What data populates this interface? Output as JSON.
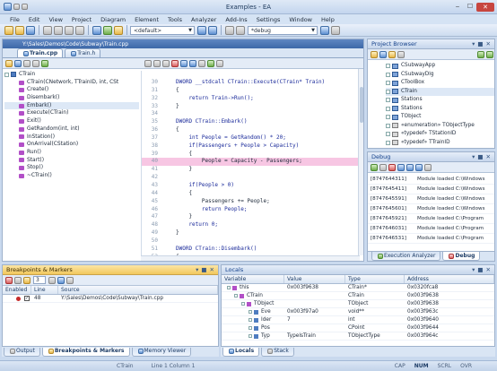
{
  "window": {
    "title": "Examples - EA"
  },
  "menu": [
    "File",
    "Edit",
    "View",
    "Project",
    "Diagram",
    "Element",
    "Tools",
    "Analyzer",
    "Add-Ins",
    "Settings",
    "Window",
    "Help"
  ],
  "toolbar": {
    "default_select": "<default>",
    "debug_select": "*debug"
  },
  "path": {
    "text": "Y:\\Sales\\Demos\\Code\\Subway\\Train.cpp"
  },
  "tabs": [
    {
      "label": "Train.cpp"
    },
    {
      "label": "Train.h"
    }
  ],
  "classtree": {
    "root": "CTrain",
    "members": [
      "CTrain(CNetwork, TTrainID, int, CSt",
      "Create()",
      "Disembark()",
      "Embark()",
      "Execute(CTrain)",
      "Exit()",
      "GetRandom(int, int)",
      "InStation()",
      "OnArrival(CStation)",
      "Run()",
      "Start()",
      "Stop()",
      "~CTrain()"
    ]
  },
  "code": {
    "lines": [
      {
        "n": "30",
        "t": "DWORD __stdcall CTrain::Execute(CTrain* Train)"
      },
      {
        "n": "31",
        "t": "{"
      },
      {
        "n": "32",
        "t": "    return Train->Run();"
      },
      {
        "n": "33",
        "t": "}"
      },
      {
        "n": "34",
        "t": ""
      },
      {
        "n": "35",
        "t": "DWORD CTrain::Embark()"
      },
      {
        "n": "36",
        "t": "{"
      },
      {
        "n": "37",
        "t": "    int People = GetRandom() * 20;"
      },
      {
        "n": "38",
        "t": "    if(Passengers + People > Capacity)"
      },
      {
        "n": "39",
        "t": "    {"
      },
      {
        "n": "40",
        "t": "        People = Capacity - Passengers;"
      },
      {
        "n": "41",
        "t": "    }"
      },
      {
        "n": "42",
        "t": ""
      },
      {
        "n": "43",
        "t": "    if(People > 0)"
      },
      {
        "n": "44",
        "t": "    {"
      },
      {
        "n": "45",
        "t": "        Passengers += People;"
      },
      {
        "n": "46",
        "t": "        return People;"
      },
      {
        "n": "47",
        "t": "    }"
      },
      {
        "n": "48",
        "t": "    return 0;"
      },
      {
        "n": "49",
        "t": "}"
      },
      {
        "n": "50",
        "t": ""
      },
      {
        "n": "51",
        "t": "DWORD CTrain::Disembark()"
      },
      {
        "n": "52",
        "t": "{"
      },
      {
        "n": "53",
        "t": "    int People = GetRandom();"
      }
    ],
    "highlight_line": "40"
  },
  "project_browser": {
    "title": "Project Browser",
    "items": [
      "CSubwayApp",
      "CSubwayDlg",
      "CToolBox",
      "CTrain",
      "Stations",
      "Stations",
      "TObject",
      "«enumeration» TObjectType",
      "«typedef» TStationID",
      "«typedef» TTrainID"
    ]
  },
  "debug": {
    "title": "Debug",
    "rows": [
      {
        "id": "[8747644311]",
        "msg": "Module loaded C:\\Windows"
      },
      {
        "id": "[8747645411]",
        "msg": "Module loaded C:\\Windows"
      },
      {
        "id": "[8747645591]",
        "msg": "Module loaded C:\\Windows"
      },
      {
        "id": "[8747645601]",
        "msg": "Module loaded C:\\Windows"
      },
      {
        "id": "[8747645921]",
        "msg": "Module loaded C:\\Program"
      },
      {
        "id": "[8747646031]",
        "msg": "Module loaded C:\\Program"
      },
      {
        "id": "[8747646531]",
        "msg": "Module loaded C:\\Program"
      }
    ],
    "tabs": [
      "Execution Analyzer",
      "Debug"
    ]
  },
  "breakpoints": {
    "title": "Breakpoints & Markers",
    "count": "3",
    "headers": [
      "Enabled",
      "Line",
      "Source"
    ],
    "rows": [
      {
        "line": "48",
        "source": "Y:\\Sales\\Demos\\Code\\Subway\\Train.cpp"
      }
    ]
  },
  "locals": {
    "title": "Locals",
    "headers": [
      "Variable",
      "Value",
      "Type",
      "Address"
    ],
    "rows": [
      {
        "v": "this",
        "val": "0x003f9638",
        "type": "CTrain*",
        "addr": "0x0320fca8"
      },
      {
        "v": "CTrain",
        "val": "",
        "type": "CTrain",
        "addr": "0x003f9638"
      },
      {
        "v": "TObject",
        "val": "",
        "type": "TObject",
        "addr": "0x003f9638"
      },
      {
        "v": "Eve",
        "val": "0x003f97a0",
        "type": "void**",
        "addr": "0x003f963c"
      },
      {
        "v": "Ider",
        "val": "7",
        "type": "int",
        "addr": "0x003f9640"
      },
      {
        "v": "Pos",
        "val": "",
        "type": "CPoint",
        "addr": "0x003f9644"
      },
      {
        "v": "Typ",
        "val": "TypeIsTrain",
        "type": "TObjectType",
        "addr": "0x003f964c"
      }
    ]
  },
  "bottom_tabs_left": [
    "Output",
    "Breakpoints & Markers",
    "Memory Viewer"
  ],
  "bottom_tabs_right": [
    "Locals",
    "Stack"
  ],
  "status": {
    "element": "CTrain",
    "position": "Line 1 Column 1",
    "caps": "CAP",
    "num": "NUM",
    "scrl": "SCRL",
    "ovr": "OVR"
  }
}
